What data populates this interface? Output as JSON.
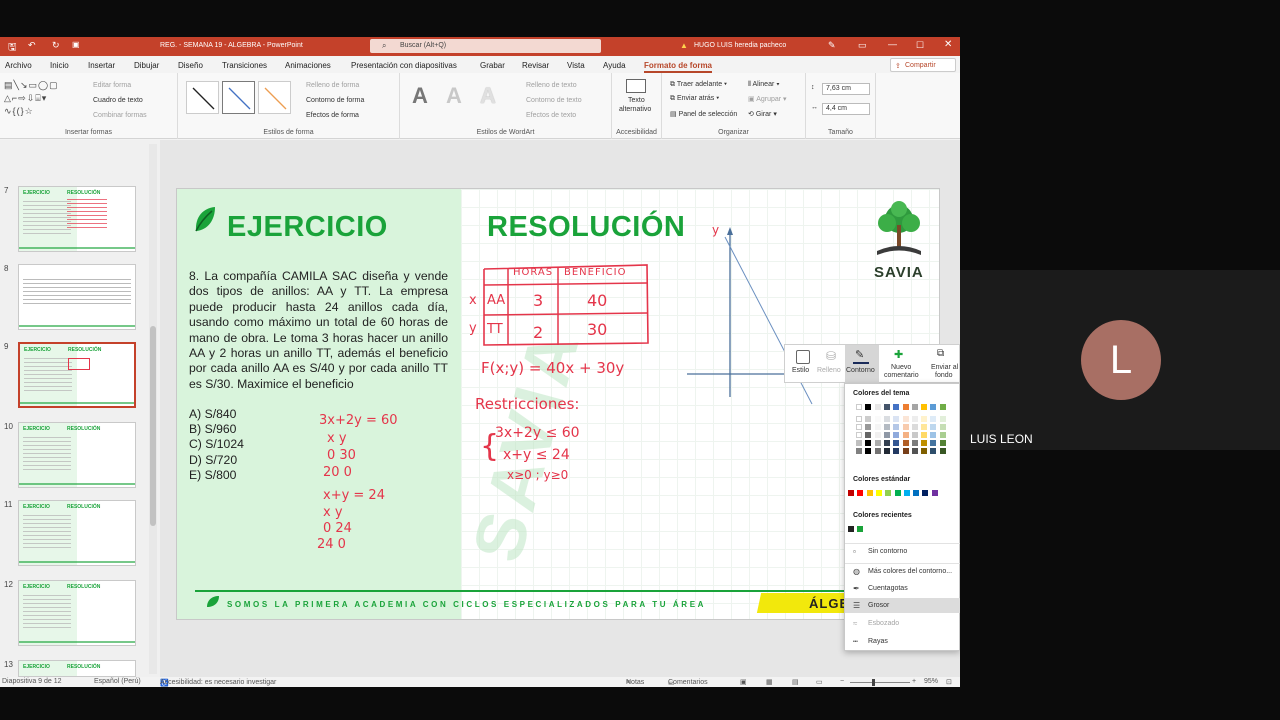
{
  "window": {
    "title": "REG. - SEMANA 19 - ALGEBRA  -  PowerPoint",
    "search_placeholder": "Buscar (Alt+Q)",
    "user": "HUGO LUIS heredia pacheco"
  },
  "menu": [
    "Archivo",
    "Inicio",
    "Insertar",
    "Dibujar",
    "Diseño",
    "Transiciones",
    "Animaciones",
    "Presentación con diapositivas",
    "Grabar",
    "Revisar",
    "Vista",
    "Ayuda",
    "Formato de forma"
  ],
  "share_label": "Compartir",
  "ribbon": {
    "insert_shapes": {
      "edit_shape": "Editar forma",
      "text_box": "Cuadro de texto",
      "combine": "Combinar formas",
      "label": "Insertar formas"
    },
    "shape_styles": {
      "fill": "Relleno de forma",
      "outline": "Contorno de forma",
      "effects": "Efectos de forma",
      "label": "Estilos de forma"
    },
    "wordart": {
      "text_fill": "Relleno de texto",
      "text_outline": "Contorno de texto",
      "text_effects": "Efectos de texto",
      "label": "Estilos de WordArt",
      "sample": "A"
    },
    "accessibility": {
      "alt_text_1": "Texto",
      "alt_text_2": "alternativo",
      "label": "Accesibilidad"
    },
    "arrange": {
      "bring_forward": "Traer adelante",
      "send_backward": "Enviar atrás",
      "selection_pane": "Panel de selección",
      "align": "Alinear",
      "group": "Agrupar",
      "rotate": "Girar",
      "label": "Organizar"
    },
    "size": {
      "height": "7,63 cm",
      "width": "4,4 cm",
      "label": "Tamaño"
    }
  },
  "thumbnails": [
    {
      "num": "7",
      "t1": "EJERCICIO",
      "t2": "RESOLUCIÓN"
    },
    {
      "num": "8",
      "t1": "",
      "t2": ""
    },
    {
      "num": "9",
      "t1": "EJERCICIO",
      "t2": "RESOLUCIÓN"
    },
    {
      "num": "10",
      "t1": "EJERCICIO",
      "t2": "RESOLUCIÓN"
    },
    {
      "num": "11",
      "t1": "EJERCICIO",
      "t2": "RESOLUCIÓN"
    },
    {
      "num": "12",
      "t1": "EJERCICIO",
      "t2": "RESOLUCIÓN"
    },
    {
      "num": "13",
      "t1": "EJERCICIO",
      "t2": "RESOLUCIÓN"
    }
  ],
  "slide": {
    "left_title": "EJERCICIO",
    "right_title": "RESOLUCIÓN",
    "problem": "8. La compañía CAMILA SAC diseña y vende dos tipos de anillos: AA y TT. La empresa puede producir hasta 24 anillos cada día, usando como máximo un total de 60 horas de mano de obra. Le toma 3 horas hacer un anillo AA y 2 horas un anillo TT, además el beneficio por cada anillo AA es S/40 y por cada anillo TT es S/30. Maximice el beneficio",
    "options": [
      "A) S/840",
      "B) S/960",
      "C) S/1024",
      "D) S/720",
      "E) S/800"
    ],
    "handwriting_left": [
      "3x+2y = 60",
      "x   y",
      "0   30",
      "20   0",
      "x+y = 24",
      "x   y",
      "0  24",
      "24   0"
    ],
    "table": {
      "headers": [
        "HORAS",
        "BENEFICIO"
      ],
      "rows": [
        {
          "var": "x",
          "name": "AA",
          "horas": "3",
          "beneficio": "40"
        },
        {
          "var": "y",
          "name": "TT",
          "horas": "2",
          "beneficio": "30"
        }
      ]
    },
    "objective": "F(x;y) = 40x + 30y",
    "restrictions_title": "Restricciones:",
    "restrictions": [
      "3x+2y ≤ 60",
      "x+y ≤ 24",
      "x≥0 ; y≥0"
    ],
    "axis_label": "y",
    "logo_text": "SAVIA",
    "watermark": "SAVIA",
    "footer": "SOMOS LA PRIMERA ACADEMIA CON CICLOS ESPECIALIZADOS PARA TU ÁREA",
    "subject_tag": "ÁLGE"
  },
  "shape_toolbar": {
    "style": "Estilo",
    "fill": "Relleno",
    "outline": "Contorno",
    "new_comment_1": "Nuevo",
    "new_comment_2": "comentario",
    "send_back_1": "Enviar al",
    "send_back_2": "fondo"
  },
  "contour_menu": {
    "theme_colors": "Colores del tema",
    "standard_colors": "Colores estándar",
    "recent_colors": "Colores recientes",
    "no_outline": "Sin contorno",
    "more_colors": "Más colores del contorno...",
    "eyedropper": "Cuentagotas",
    "weight": "Grosor",
    "sketched": "Esbozado",
    "dashes": "Rayas",
    "theme_row": [
      "#ffffff",
      "#000000",
      "#e7e6e6",
      "#44546a",
      "#4472c4",
      "#ed7d31",
      "#a5a5a5",
      "#ffc000",
      "#5b9bd5",
      "#70ad47"
    ],
    "standard_row": [
      "#c00000",
      "#ff0000",
      "#ffc000",
      "#ffff00",
      "#92d050",
      "#00b050",
      "#00b0f0",
      "#0070c0",
      "#002060",
      "#7030a0"
    ],
    "recent_row": [
      "#222222",
      "#1aa33a"
    ]
  },
  "status": {
    "slide_of": "Diapositiva 9 de 12",
    "language": "Español (Perú)",
    "accessibility": "Accesibilidad: es necesario investigar",
    "notes": "Notas",
    "comments": "Comentarios",
    "zoom": "95%"
  },
  "call": {
    "initial": "L",
    "name": "LUIS LEON"
  },
  "colors": {
    "accent": "#c4412a",
    "brand_green": "#1aa33a",
    "ink_red": "#e4354a",
    "avatar": "#a86f64"
  }
}
